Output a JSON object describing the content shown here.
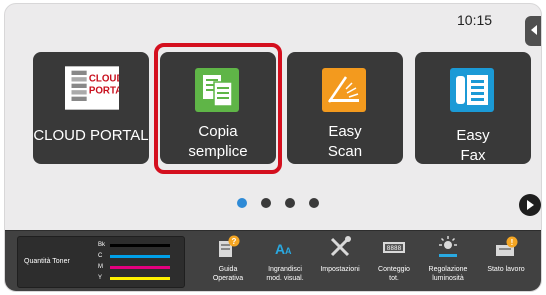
{
  "status": {
    "time": "10:15"
  },
  "tiles": [
    {
      "id": "cloud-portal",
      "label_line1": "CLOUD PORTAL",
      "logo_text1": "CLOUD",
      "logo_text2": "PORTAL"
    },
    {
      "id": "copia-semplice",
      "label_line1": "Copia",
      "label_line2": "semplice",
      "selected": true
    },
    {
      "id": "easy-scan",
      "label_line1": "Easy",
      "label_line2": "Scan"
    },
    {
      "id": "easy-fax",
      "label_line1": "Easy",
      "label_line2": "Fax"
    }
  ],
  "pager": {
    "pages": 4,
    "current": 1
  },
  "taskbar": {
    "toner": {
      "label": "Quantità Toner",
      "rows": [
        {
          "key": "Bk",
          "color": "#000000",
          "level": 1.0
        },
        {
          "key": "C",
          "color": "#00a0e9",
          "level": 1.0
        },
        {
          "key": "M",
          "color": "#e4007f",
          "level": 1.0
        },
        {
          "key": "Y",
          "color": "#fff100",
          "level": 1.0
        }
      ]
    },
    "items": [
      {
        "id": "guida-operativa",
        "line1": "Guida",
        "line2": "Operativa",
        "icon": "book-help-icon"
      },
      {
        "id": "ingrandisci",
        "line1": "Ingrandisci",
        "line2": "mod. visual.",
        "icon": "text-zoom-icon"
      },
      {
        "id": "impostazioni",
        "line1": "Impostazioni",
        "line2": "",
        "icon": "tools-icon"
      },
      {
        "id": "conteggio",
        "line1": "Conteggio",
        "line2": "tot.",
        "icon": "counter-icon"
      },
      {
        "id": "regolazione",
        "line1": "Regolazione",
        "line2": "luminosità",
        "icon": "brightness-icon"
      },
      {
        "id": "stato-lavoro",
        "line1": "Stato lavoro",
        "line2": "",
        "icon": "job-status-icon"
      }
    ]
  },
  "colors": {
    "highlight": "#d40f1e",
    "tile_bg": "#393939",
    "dot_active": "#2e8ad6"
  }
}
